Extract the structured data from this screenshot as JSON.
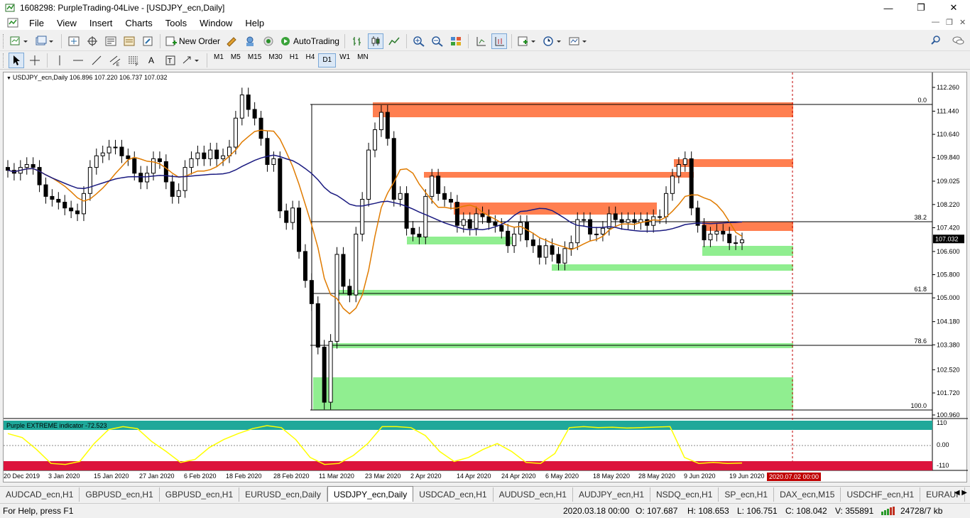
{
  "window": {
    "title": "1608298: PurpleTrading-04Live - [USDJPY_ecn,Daily]",
    "min": "—",
    "max": "❐",
    "close": "✕"
  },
  "menu": {
    "items": [
      "File",
      "View",
      "Insert",
      "Charts",
      "Tools",
      "Window",
      "Help"
    ]
  },
  "toolbar": {
    "new_order": "New Order",
    "autotrading": "AutoTrading"
  },
  "timeframes": [
    "M1",
    "M5",
    "M15",
    "M30",
    "H1",
    "H4",
    "D1",
    "W1",
    "MN"
  ],
  "active_timeframe": "D1",
  "chart": {
    "symbol_info": "USDJPY_ecn,Daily  106.896 107.220 106.737 107.032",
    "current_price": "107.032",
    "current_price_color": "#000000",
    "price_labels": [
      "112.260",
      "111.440",
      "110.640",
      "109.840",
      "109.025",
      "108.220",
      "107.420",
      "106.600",
      "105.800",
      "105.000",
      "104.180",
      "103.380",
      "102.520",
      "101.720",
      "100.960"
    ],
    "fib_labels": [
      "0.0",
      "38.2",
      "61.8",
      "78.6",
      "100.0"
    ],
    "date_labels": [
      "20 Dec 2019",
      "3 Jan 2020",
      "15 Jan 2020",
      "27 Jan 2020",
      "6 Feb 2020",
      "18 Feb 2020",
      "28 Feb 2020",
      "11 Mar 2020",
      "23 Mar 2020",
      "2 Apr 2020",
      "14 Apr 2020",
      "24 Apr 2020",
      "6 May 2020",
      "18 May 2020",
      "28 May 2020",
      "9 Jun 2020",
      "19 Jun 2020"
    ],
    "future_date": "2020.07.02 00:00",
    "indicator_label": "Purple EXTREME indicator -72.523",
    "indicator_levels": [
      "110",
      "0.00",
      "-110"
    ],
    "colors": {
      "supply": "#ff7f50",
      "demand": "#90ee90",
      "ma_fast": "#e07b00",
      "ma_slow": "#1a1a80",
      "osc": "#ffff00",
      "osc_top": "#1fa89a",
      "osc_bottom": "#dc143c"
    }
  },
  "tabs": [
    "AUDCAD_ecn,H1",
    "GBPUSD_ecn,H1",
    "GBPUSD_ecn,H1",
    "EURUSD_ecn,Daily",
    "USDJPY_ecn,Daily",
    "USDCAD_ecn,H1",
    "AUDUSD_ecn,H1",
    "AUDJPY_ecn,H1",
    "NSDQ_ecn,H1",
    "SP_ecn,H1",
    "DAX_ecn,M15",
    "USDCHF_ecn,H1",
    "EURAUI"
  ],
  "active_tab": "USDJPY_ecn,Daily",
  "status": {
    "help": "For Help, press F1",
    "datetime": "2020.03.18 00:00",
    "open": "O: 107.687",
    "high": "H: 108.653",
    "low": "L: 106.751",
    "close": "C: 108.042",
    "volume": "V: 355891",
    "traffic": "24728/7 kb"
  }
}
